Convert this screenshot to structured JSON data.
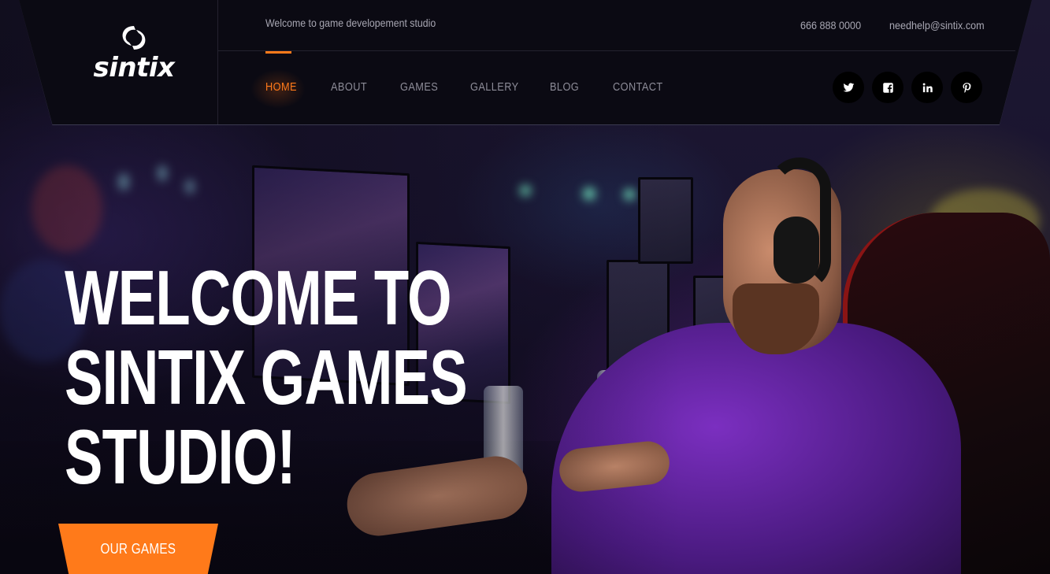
{
  "brand": {
    "name": "sintix"
  },
  "topbar": {
    "tagline": "Welcome to game developement studio",
    "phone": "666 888 0000",
    "email": "needhelp@sintix.com"
  },
  "nav": {
    "items": [
      {
        "label": "HOME",
        "active": true
      },
      {
        "label": "ABOUT",
        "active": false
      },
      {
        "label": "GAMES",
        "active": false
      },
      {
        "label": "GALLERY",
        "active": false
      },
      {
        "label": "BLOG",
        "active": false
      },
      {
        "label": "CONTACT",
        "active": false
      }
    ]
  },
  "social": [
    {
      "icon": "twitter-icon"
    },
    {
      "icon": "facebook-icon"
    },
    {
      "icon": "linkedin-icon"
    },
    {
      "icon": "pinterest-icon"
    }
  ],
  "hero": {
    "title_lines": [
      "WELCOME TO",
      "SINTIX GAMES",
      "STUDIO!"
    ],
    "cta_label": "OUR GAMES"
  },
  "colors": {
    "accent": "#ff7a1a",
    "header_bg": "#0b0a13",
    "text_muted": "#a7a6b2",
    "nav_text": "#8d8c98"
  }
}
